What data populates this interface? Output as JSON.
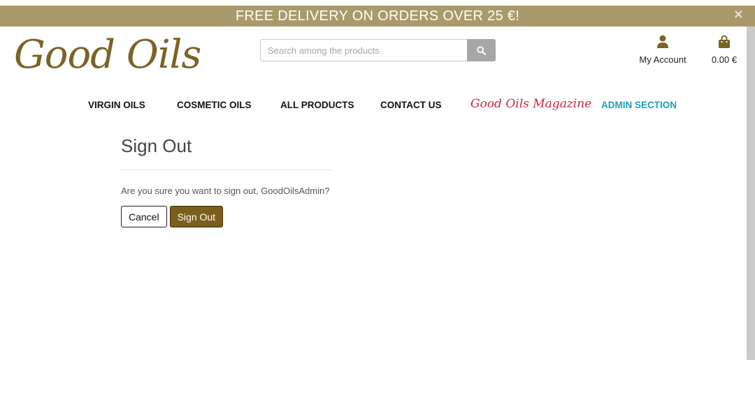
{
  "banner": {
    "text": "FREE DELIVERY ON ORDERS OVER 25 €!",
    "close_icon": "close-icon",
    "close_glyph": "×",
    "background": "#a99a6b"
  },
  "header": {
    "logo_text": "Good Oils",
    "search": {
      "placeholder": "Search among the products",
      "value": "",
      "icon": "search-icon"
    },
    "account": {
      "label": "My Account",
      "icon": "user-icon"
    },
    "cart": {
      "label": "0.00 €",
      "icon": "shopping-bag-icon"
    }
  },
  "nav": {
    "items": [
      {
        "label": "VIRGIN OILS"
      },
      {
        "label": "COSMETIC OILS"
      },
      {
        "label": "ALL PRODUCTS"
      },
      {
        "label": "CONTACT US"
      },
      {
        "label": "Good Oils Magazine"
      },
      {
        "label": "ADMIN SECTION"
      }
    ]
  },
  "main": {
    "title": "Sign Out",
    "message": "Are you sure you want to sign out, GoodOilsAdmin?",
    "cancel_label": "Cancel",
    "signout_label": "Sign Out"
  },
  "colors": {
    "brand_gold": "#7b6325",
    "button_brown": "#7b5e1c",
    "magazine_red": "#c8283a",
    "admin_teal": "#1aa0b8"
  }
}
